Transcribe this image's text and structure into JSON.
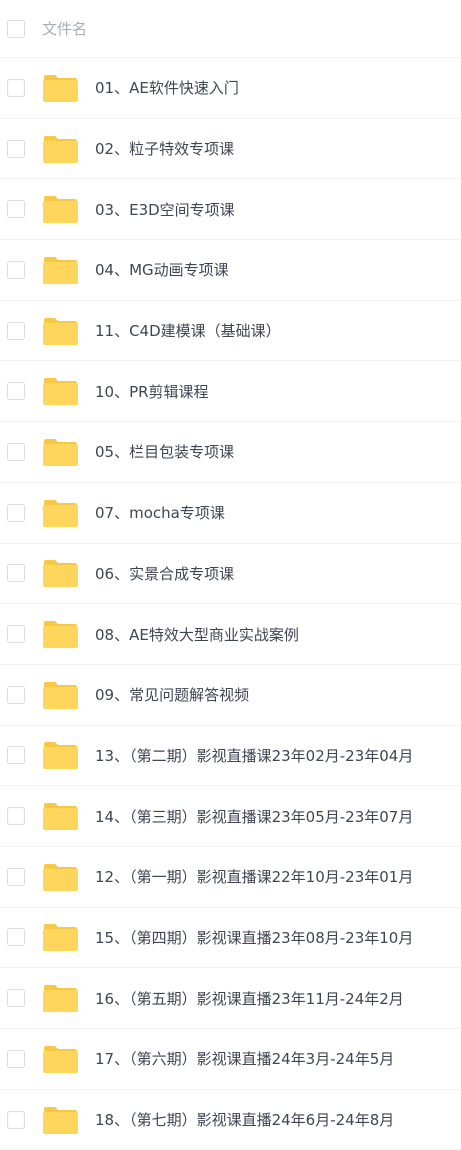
{
  "header": {
    "column_label": "文件名"
  },
  "files": [
    {
      "name": "01、AE软件快速入门",
      "icon": "folder-icon"
    },
    {
      "name": "02、粒子特效专项课",
      "icon": "folder-icon"
    },
    {
      "name": "03、E3D空间专项课",
      "icon": "folder-icon"
    },
    {
      "name": "04、MG动画专项课",
      "icon": "folder-icon"
    },
    {
      "name": "11、C4D建模课（基础课）",
      "icon": "folder-icon"
    },
    {
      "name": "10、PR剪辑课程",
      "icon": "folder-icon"
    },
    {
      "name": "05、栏目包装专项课",
      "icon": "folder-icon"
    },
    {
      "name": "07、mocha专项课",
      "icon": "folder-icon"
    },
    {
      "name": "06、实景合成专项课",
      "icon": "folder-icon"
    },
    {
      "name": "08、AE特效大型商业实战案例",
      "icon": "folder-icon"
    },
    {
      "name": "09、常见问题解答视频",
      "icon": "folder-icon"
    },
    {
      "name": "13、（第二期）影视直播课23年02月-23年04月",
      "icon": "folder-icon"
    },
    {
      "name": "14、（第三期）影视直播课23年05月-23年07月",
      "icon": "folder-icon"
    },
    {
      "name": "12、（第一期）影视直播课22年10月-23年01月",
      "icon": "folder-icon"
    },
    {
      "name": "15、（第四期）影视课直播23年08月-23年10月",
      "icon": "folder-icon"
    },
    {
      "name": "16、（第五期）影视课直播23年11月-24年2月",
      "icon": "folder-icon"
    },
    {
      "name": "17、（第六期）影视课直播24年3月-24年5月",
      "icon": "folder-icon"
    },
    {
      "name": "18、（第七期）影视课直播24年6月-24年8月",
      "icon": "folder-icon"
    }
  ],
  "colors": {
    "folder_body": "#ffd65c",
    "folder_tab": "#f7c843",
    "text": "#3f4552",
    "header_text": "#a9adb5",
    "divider": "#f2f3f5"
  }
}
